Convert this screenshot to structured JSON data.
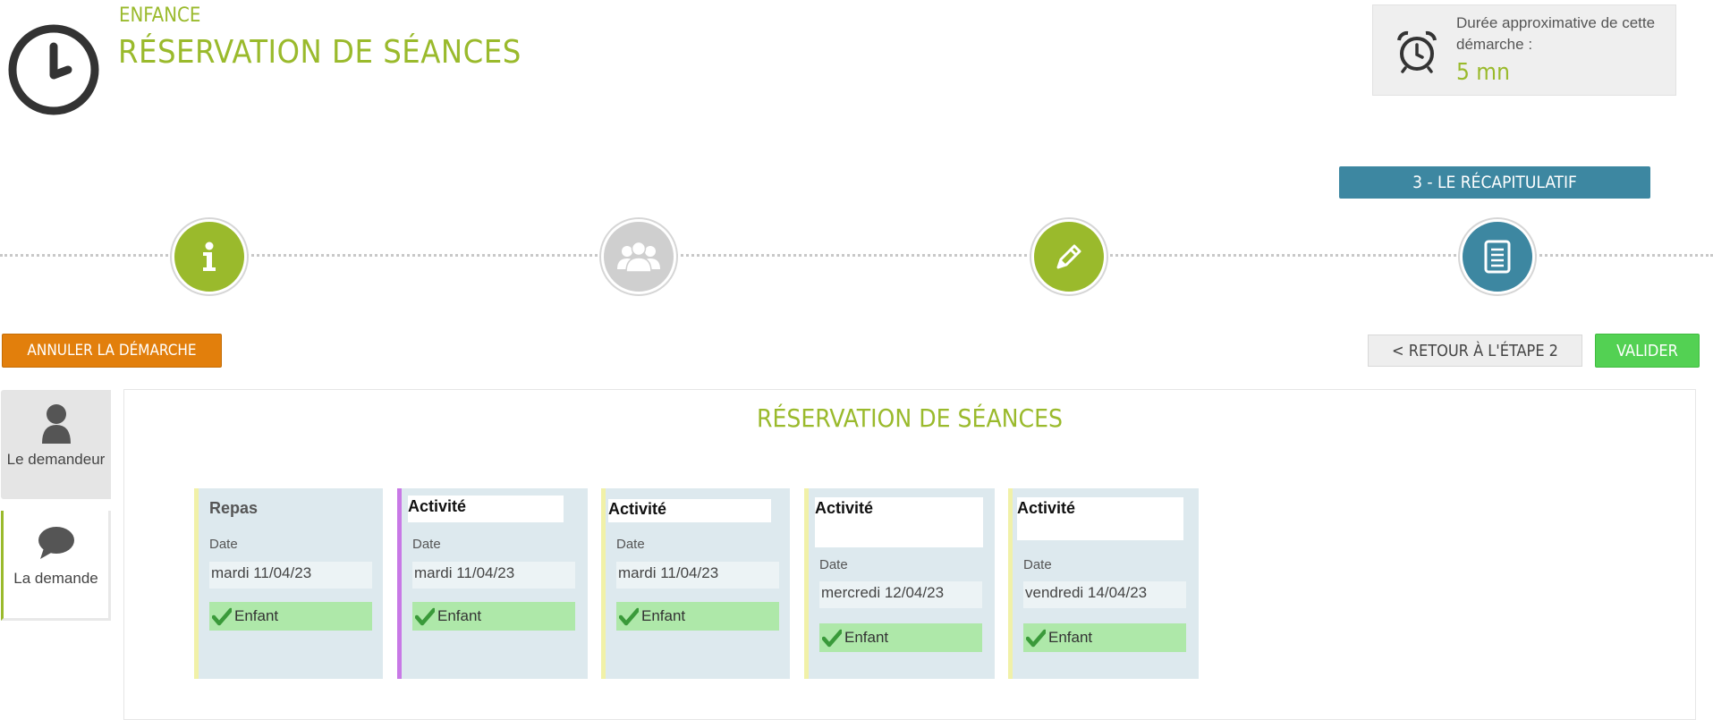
{
  "header": {
    "category": "ENFANCE",
    "title": "RÉSERVATION DE SÉANCES",
    "duration_label": "Durée approximative de cette démarche :",
    "duration_value": "5 mn"
  },
  "steps": {
    "current_label": "3 - LE RÉCAPITULATIF",
    "items": [
      {
        "icon": "info-icon",
        "color": "#9aba2c"
      },
      {
        "icon": "group-icon",
        "color": "#cfcfcf"
      },
      {
        "icon": "pencil-icon",
        "color": "#9aba2c"
      },
      {
        "icon": "document-icon",
        "color": "#3d87a1"
      }
    ]
  },
  "actions": {
    "cancel": "ANNULER LA DÉMARCHE",
    "back": "< RETOUR À L'ÉTAPE 2",
    "validate": "VALIDER"
  },
  "sidebar": {
    "items": [
      {
        "label": "Le demandeur",
        "icon": "user-icon"
      },
      {
        "label": "La demande",
        "icon": "speech-bubble-icon"
      }
    ]
  },
  "main": {
    "title": "RÉSERVATION DE SÉANCES",
    "date_label": "Date",
    "cards": [
      {
        "title": "Repas",
        "date": "mardi 11/04/23",
        "badge": "Enfant",
        "strip_color": "#f1f1a8"
      },
      {
        "title": "Activité",
        "date": "mardi 11/04/23",
        "badge": "Enfant",
        "strip_color": "#c879e6"
      },
      {
        "title": "Activité",
        "date": "mardi 11/04/23",
        "badge": "Enfant",
        "strip_color": "#f1f1a8"
      },
      {
        "title": "Activité",
        "date": "mercredi 12/04/23",
        "badge": "Enfant",
        "strip_color": "#f1f1a8"
      },
      {
        "title": "Activité",
        "date": "vendredi 14/04/23",
        "badge": "Enfant",
        "strip_color": "#f1f1a8"
      }
    ]
  },
  "colors": {
    "accent_green": "#9aba2c",
    "step_blue": "#3d87a1",
    "cancel_orange": "#e27f0c",
    "validate_green": "#53d153"
  }
}
